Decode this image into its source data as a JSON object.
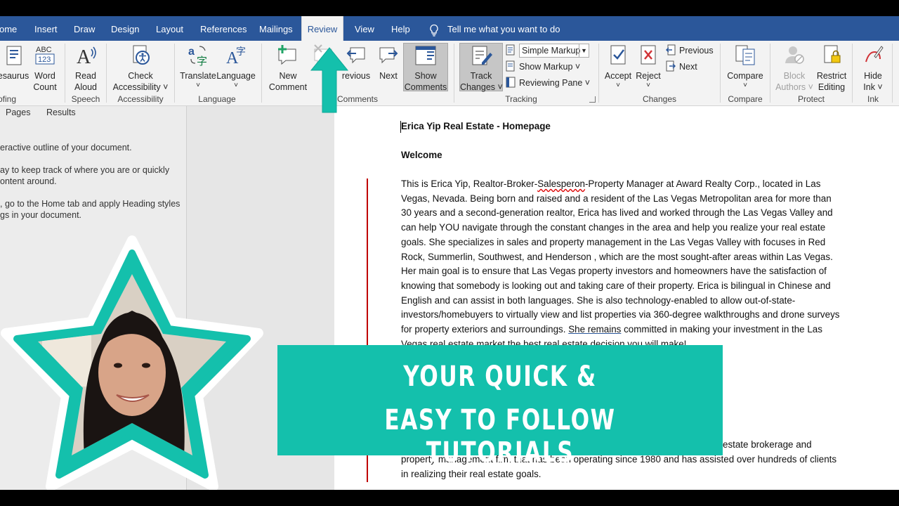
{
  "tabs": [
    {
      "label": "ome",
      "left": -1
    },
    {
      "label": "Insert"
    },
    {
      "label": "Draw"
    },
    {
      "label": "Design"
    },
    {
      "label": "Layout"
    },
    {
      "label": "References"
    },
    {
      "label": "Mailings"
    },
    {
      "label": "Review",
      "active": true
    },
    {
      "label": "View"
    },
    {
      "label": "Help"
    }
  ],
  "tell_me": "Tell me what you want to do",
  "ribbon": {
    "thesaurus": "esaurus",
    "word_count": [
      "Word",
      "Count"
    ],
    "read_aloud": [
      "Read",
      "Aloud"
    ],
    "check_accessibility": [
      "Check",
      "Accessibility ˅"
    ],
    "translate": "Translate",
    "language": "Language",
    "new_comment": [
      "New",
      "Comment"
    ],
    "previous_comment": "revious",
    "next_comment": "Next",
    "show_comments": [
      "Show",
      "Comments"
    ],
    "track_changes": [
      "Track",
      "Changes ˅"
    ],
    "markup_select": "Simple Markup",
    "show_markup": "Show Markup ˅",
    "reviewing_pane": "Reviewing Pane  ˅",
    "accept": "Accept",
    "reject": "Reject",
    "previous_change": "Previous",
    "next_change": "Next",
    "compare": "Compare",
    "block_authors": [
      "Block",
      "Authors ˅"
    ],
    "restrict_editing": [
      "Restrict",
      "Editing"
    ],
    "hide_ink": [
      "Hide",
      "Ink ˅"
    ],
    "groups": {
      "proofing": "ofing",
      "speech": "Speech",
      "accessibility": "Accessibility",
      "language": "Language",
      "comments": "Comments",
      "tracking": "Tracking",
      "changes": "Changes",
      "compare": "Compare",
      "protect": "Protect",
      "ink": "Ink"
    }
  },
  "nav": {
    "tab_pages": "Pages",
    "tab_results": "Results",
    "line1": "eractive outline of your document.",
    "line2a": "ay to keep track of where you are or quickly",
    "line2b": "ontent around.",
    "line3a": ", go to the Home tab and apply Heading styles",
    "line3b": "gs in your document."
  },
  "doc": {
    "title": "Erica Yip Real Estate - Homepage",
    "welcome": "Welcome",
    "p1_a": "This is Erica Yip, Realtor-Broker-",
    "p1_misspelled": "Salesperon",
    "p1_b": "-Property Manager at Award Realty Corp., located in Las Vegas, Nevada. Being born and raised and  a resident of the Las Vegas Metropolitan area for more than 30 years and a second-generation realtor, Erica has lived and worked through the Las Vegas Valley and can help YOU navigate through the constant changes in the area and help you realize your real estate goals. She specializes in sales and property management in the Las Vegas Valley with focuses in Red Rock, Summerlin, Southwest, and Henderson , which are the most sought-after areas within Las Vegas. Her main goal is to ensure that Las Vegas property investors and homeowners have the satisfaction of knowing that somebody is looking out and taking care of their property. Erica is bilingual in Chinese and English and can assist in both languages. She is also technology-enabled to allow out-of-state-investors/homebuyers to virtually view and list properties via 360-degree walkthroughs and drone surveys for property exteriors and surroundings.  ",
    "p1_flagged": "She  remains",
    "p1_c": " committed in making your investment in the Las Vegas real estate market the best real estate decision you will make!",
    "p2_line1": "estate brokerage and",
    "p2_rest": "property management firm that has been operating since 1980 and has assisted over hundreds of clients in realizing their real estate goals."
  },
  "banner": {
    "line1": "YOUR QUICK &",
    "line2": "EASY TO FOLLOW  TUTORIALS"
  },
  "colors": {
    "word_blue": "#2b579a",
    "teal": "#14c0ac",
    "track_red": "#c00000"
  }
}
